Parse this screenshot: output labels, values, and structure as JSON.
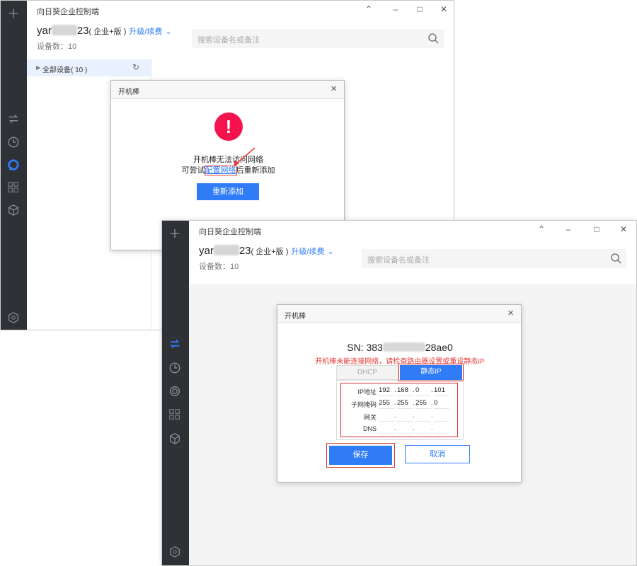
{
  "window_back": {
    "title": "向日葵企业控制端",
    "user_prefix": "yar",
    "user_suffix": "23",
    "edition": "( 企业+版 )",
    "upgrade": "升级/续费",
    "device_count": "设备数：10",
    "search_placeholder": "搜索设备名或备注",
    "tree_all": "全部设备( 10 )",
    "dialog": {
      "title": "开机棒",
      "line1": "开机棒无法访问网络",
      "line2_pre": "可尝试",
      "line2_link": "配置网络",
      "line2_post": "后重新添加",
      "button": "重新添加"
    }
  },
  "window_front": {
    "title": "向日葵企业控制端",
    "user_prefix": "yar",
    "user_suffix": "23",
    "edition": "( 企业+版 )",
    "upgrade": "升级/续费",
    "device_count": "设备数：10",
    "search_placeholder": "搜索设备名或备注",
    "dialog": {
      "title": "开机棒",
      "sn_prefix": "SN: 383",
      "sn_suffix": "28ae0",
      "warning": "开机棒未能连接网络，请检查路由器设置或重设静态IP",
      "tab_dhcp": "DHCP",
      "tab_static": "静态IP",
      "fields": [
        {
          "label": "IP地址",
          "octets": [
            "192",
            "168",
            "0",
            "101"
          ]
        },
        {
          "label": "子网掩码",
          "octets": [
            "255",
            "255",
            "255",
            "0"
          ]
        },
        {
          "label": "网关",
          "octets": [
            "",
            "",
            "",
            ""
          ]
        },
        {
          "label": "DNS",
          "octets": [
            "",
            "",
            "",
            ""
          ]
        }
      ],
      "dot": ".",
      "save": "保存",
      "cancel": "取消"
    }
  },
  "icons": [
    "plus-icon",
    "transfer-icon",
    "clock-icon",
    "sunflower-icon",
    "grid-icon",
    "cube-icon",
    "settings-hex-icon",
    "minimize-icon",
    "maximize-icon",
    "close-icon",
    "collapse-icon",
    "search-icon",
    "refresh-icon",
    "error-icon"
  ],
  "colors": {
    "accent": "#2f7cf6",
    "error": "#f5134d",
    "warning": "#e53935",
    "rail": "#2e3135"
  }
}
